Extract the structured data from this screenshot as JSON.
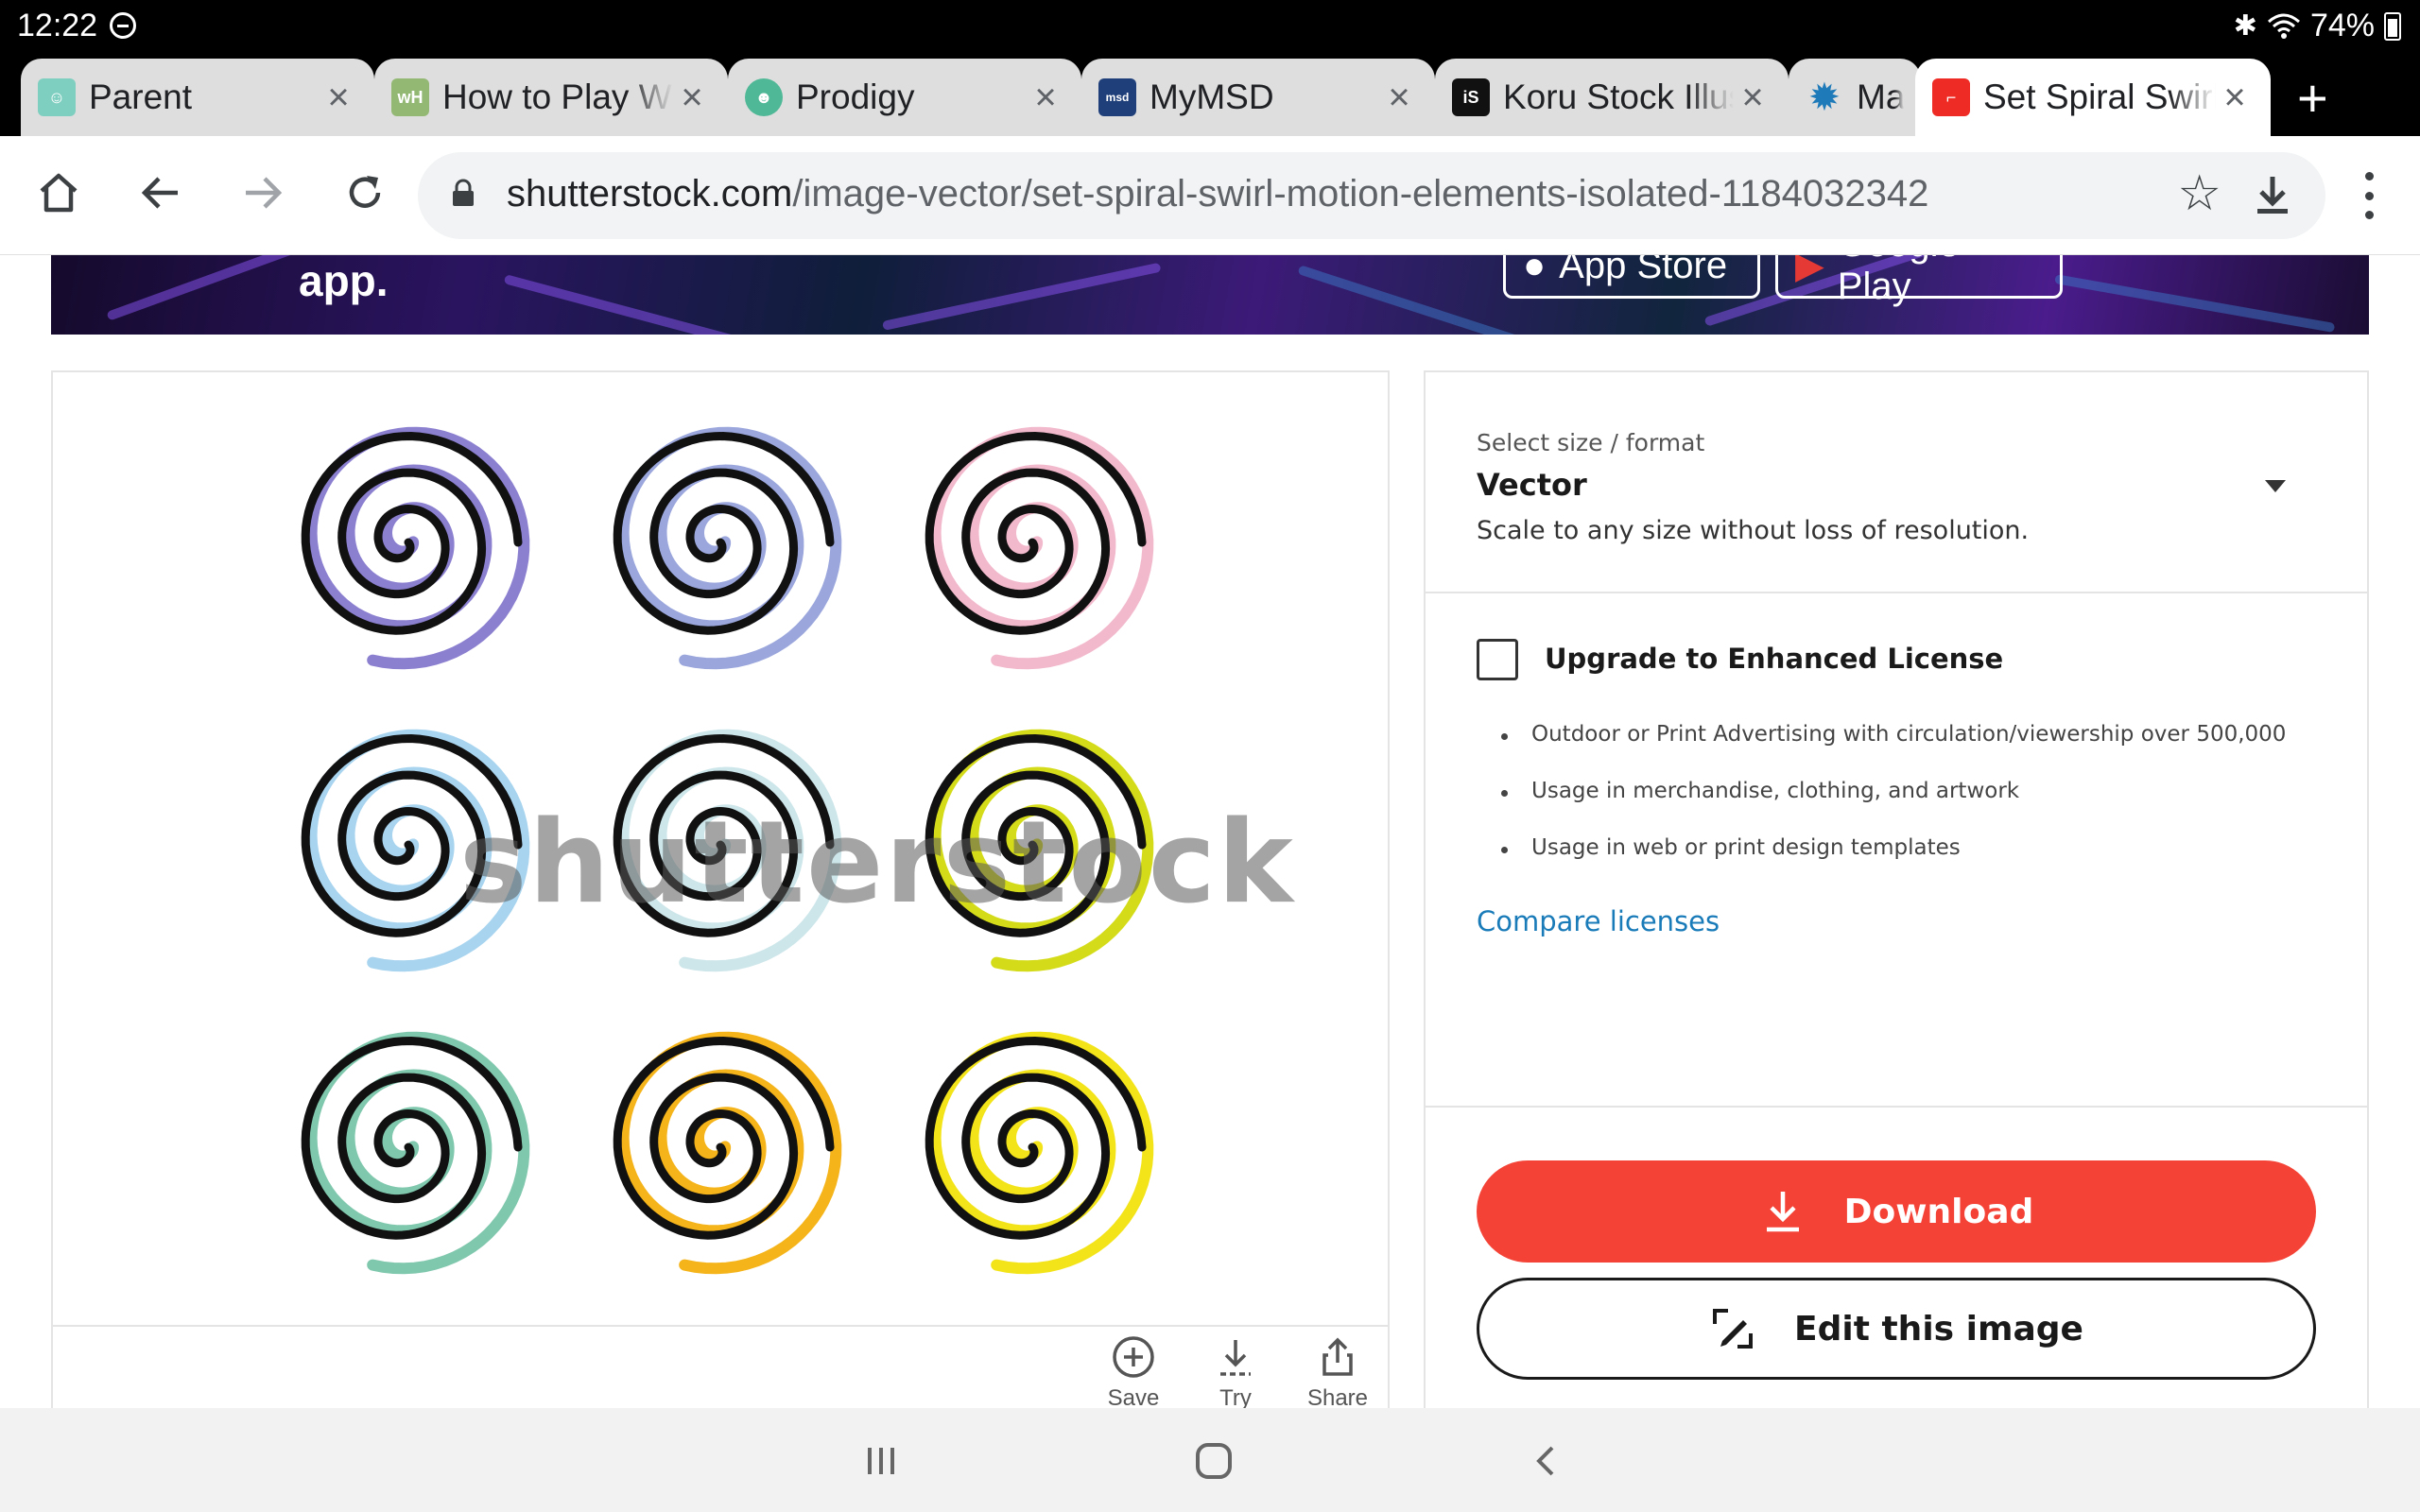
{
  "status": {
    "time": "12:22",
    "battery": "74%"
  },
  "tabs": [
    {
      "title": "Parent",
      "favicon": "parent-app-icon",
      "active": false
    },
    {
      "title": "How to Play Wi",
      "favicon": "wikihow-icon",
      "active": false
    },
    {
      "title": "Prodigy",
      "favicon": "prodigy-icon",
      "active": false
    },
    {
      "title": "MyMSD",
      "favicon": "mymsd-icon",
      "active": false
    },
    {
      "title": "Koru Stock Illus",
      "favicon": "istock-icon",
      "active": false
    },
    {
      "title": "Mar",
      "favicon": "splash-icon",
      "active": false
    },
    {
      "title": "Set Spiral Swirl",
      "favicon": "shutterstock-icon",
      "active": true
    }
  ],
  "omnibox": {
    "host": "shutterstock.com",
    "path": "/image-vector/set-spiral-swirl-motion-elements-isolated-1184032342"
  },
  "banner": {
    "text": "app.",
    "app_store": "App Store",
    "google_play": "Google Play"
  },
  "image": {
    "watermark": "shutterstock",
    "actions": {
      "save": "Save",
      "try": "Try",
      "share": "Share"
    },
    "spiral_colors": [
      "#8b7fd0",
      "#9aa6dc",
      "#f2b8cc",
      "#a8d4ef",
      "#cde6ea",
      "#d4dc1a",
      "#7fc7ad",
      "#f4b41a",
      "#f3e41a"
    ]
  },
  "license": {
    "select_label": "Select size / format",
    "format": "Vector",
    "format_desc": "Scale to any size without loss of resolution.",
    "upgrade_label": "Upgrade to Enhanced License",
    "upgrade_checked": false,
    "bullets": [
      "Outdoor or Print Advertising with circulation/viewership over 500,000",
      "Usage in merchandise, clothing, and artwork",
      "Usage in web or print design templates"
    ],
    "compare_link": "Compare licenses",
    "download_label": "Download",
    "edit_label": "Edit this image"
  },
  "colors": {
    "download_red": "#f44336",
    "link_blue": "#1a7bb9"
  }
}
